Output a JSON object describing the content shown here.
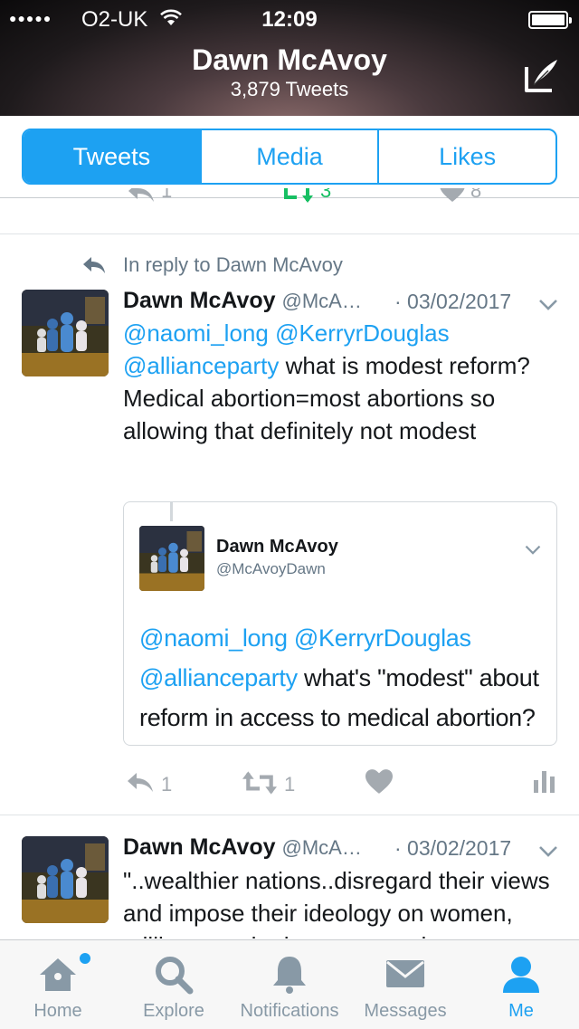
{
  "status_bar": {
    "signal": "●●●●●",
    "carrier": "O2-UK",
    "time": "12:09"
  },
  "profile_header": {
    "name": "Dawn McAvoy",
    "tweet_count": "3,879 Tweets",
    "compose_icon": "compose-tweet-icon"
  },
  "tabs": [
    {
      "label": "Tweets",
      "active": true
    },
    {
      "label": "Media",
      "active": false
    },
    {
      "label": "Likes",
      "active": false
    }
  ],
  "cut_tweet_actions": {
    "reply_count": "1",
    "retweet_count": "3",
    "like_count": "8"
  },
  "tweet1": {
    "reply_context": "In reply to Dawn McAvoy",
    "name": "Dawn McAvoy",
    "handle": "@McA…",
    "date": "· 03/02/2017",
    "mention1": "@naomi_long",
    "mention2": "@KerryrDouglas",
    "mention3": "@allianceparty",
    "text_after_mentions": " what is modest reform? Medical abortion=most abortions so allowing that definitely not modest",
    "quote": {
      "name": "Dawn McAvoy",
      "handle": "@McAvoyDawn",
      "mention1": "@naomi_long",
      "mention2": "@KerryrDouglas",
      "mention3": "@allianceparty",
      "text_after_mentions": " what's \"modest\" about reform in access to medical abortion? How many clinical?"
    },
    "reply_count": "1",
    "retweet_count": "1"
  },
  "tweet2": {
    "name": "Dawn McAvoy",
    "handle": "@McA…",
    "date": "· 03/02/2017",
    "text": "\"..wealthier nations..disregard their views and impose their ideology on women, millions ... who have no need"
  },
  "tab_bar": [
    {
      "label": "Home",
      "icon": "home-icon",
      "active": false,
      "badge": true
    },
    {
      "label": "Explore",
      "icon": "search-icon",
      "active": false
    },
    {
      "label": "Notifications",
      "icon": "bell-icon",
      "active": false
    },
    {
      "label": "Messages",
      "icon": "envelope-icon",
      "active": false
    },
    {
      "label": "Me",
      "icon": "person-icon",
      "active": true
    }
  ],
  "colors": {
    "accent": "#1da1f2",
    "retweet_green": "#17bf63",
    "muted": "#a4aab0"
  }
}
